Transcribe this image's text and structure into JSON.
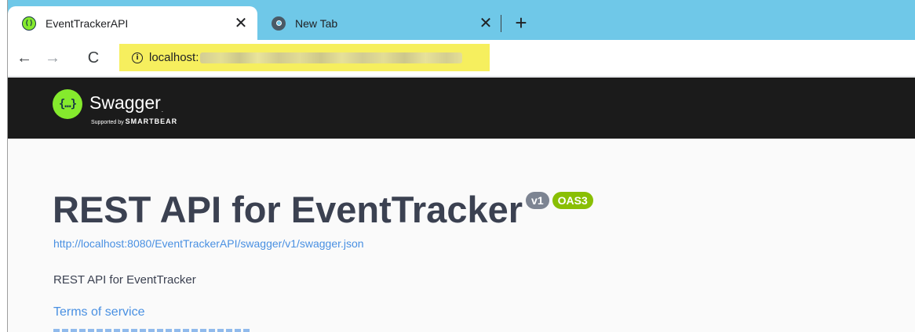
{
  "browser": {
    "tabs": [
      {
        "title": "EventTrackerAPI",
        "active": true,
        "icon": "swagger-favicon-icon"
      },
      {
        "title": "New Tab",
        "active": false,
        "icon": "chrome-favicon-icon"
      }
    ],
    "close_glyph": "✕",
    "new_tab_glyph": "+",
    "nav": {
      "back_glyph": "←",
      "forward_glyph": "→",
      "reload_glyph": "C"
    },
    "address": {
      "info_glyph": "i",
      "url_prefix": "localhost:"
    }
  },
  "topbar": {
    "logo_glyph": "{…}",
    "brand": "Swagger",
    "brand_tm": ".",
    "supported_by": "Supported by",
    "smartbear": "SMARTBEAR"
  },
  "info": {
    "title": "REST API for EventTracker",
    "version_badge": "v1",
    "oas_badge": "OAS3",
    "spec_url": "http://localhost:8080/EventTrackerAPI/swagger/v1/swagger.json",
    "description": "REST API for EventTracker",
    "terms_of_service": "Terms of service"
  },
  "colors": {
    "tabstrip": "#6fc8e8",
    "swagger_green": "#85ea2d",
    "topbar": "#1b1b1b",
    "link": "#4990e2",
    "title": "#3b4151",
    "oas_badge": "#89bf04",
    "version_badge": "#7d8492",
    "address_highlight": "#f6ef5e"
  }
}
